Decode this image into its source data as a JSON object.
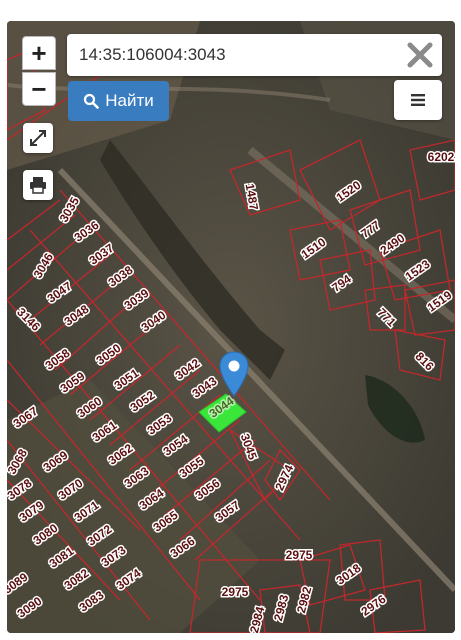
{
  "search": {
    "value": "14:35:106004:3043",
    "placeholder": ""
  },
  "buttons": {
    "zoom_in": "+",
    "zoom_out": "−",
    "find_label": "Найти"
  },
  "icons": {
    "zoom_in": "plus-icon",
    "zoom_out": "minus-icon",
    "fullscreen": "expand-icon",
    "print": "printer-icon",
    "find": "search-icon",
    "clear": "close-icon",
    "menu": "hamburger-menu-icon",
    "marker": "map-pin-icon"
  },
  "colors": {
    "parcel_border": "#c0282c",
    "selected_parcel": "#39e639",
    "button_blue": "#3a7cc0",
    "marker": "#3a8ad8"
  },
  "parcels": [
    "3035",
    "3036",
    "3037",
    "3038",
    "3039",
    "3040",
    "3046",
    "3047",
    "3048",
    "3146",
    "3058",
    "3050",
    "3059",
    "3051",
    "3060",
    "3052",
    "3061",
    "3053",
    "3062",
    "3054",
    "3063",
    "3055",
    "3064",
    "3056",
    "3065",
    "3057",
    "3066",
    "3067",
    "3069",
    "3070",
    "3071",
    "3072",
    "3073",
    "3074",
    "3078",
    "3079",
    "3080",
    "3081",
    "3082",
    "3083",
    "3089",
    "3090",
    "3042",
    "3043",
    "3045",
    "2974",
    "2975",
    "2975",
    "2983",
    "2982",
    "2976",
    "3018",
    "1487",
    "1520",
    "1510",
    "794",
    "777",
    "2490",
    "771",
    "1523",
    "1519",
    "816",
    "6202",
    "3044",
    "3068",
    "2984"
  ],
  "selected_parcel": "3044"
}
